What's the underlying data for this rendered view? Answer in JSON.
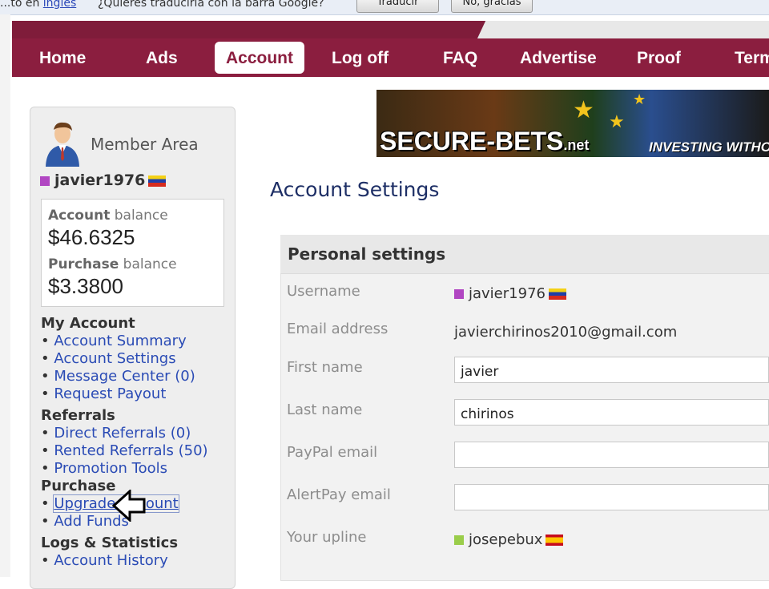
{
  "translate_bar": {
    "text_prefix": "...to en",
    "link": "inglés",
    "question": "¿Quieres traducirla con la barra Google?",
    "translate_button": "Traducir",
    "no_button": "No, gracias"
  },
  "nav": {
    "items": [
      "Home",
      "Ads",
      "Account",
      "Log off",
      "FAQ",
      "Advertise",
      "Proof",
      "Terms"
    ],
    "active": "Account"
  },
  "sidebar": {
    "member_area": "Member Area",
    "username": "javier1976",
    "account_balance_label": "Account",
    "account_balance_label2": "balance",
    "account_balance": "46.6325",
    "purchase_balance_label": "Purchase",
    "purchase_balance_label2": "balance",
    "purchase_balance": "3.3800",
    "currency": "$",
    "sections": {
      "my_account": "My Account",
      "account_summary": "Account Summary",
      "account_settings": "Account Settings",
      "message_center": "Message Center",
      "message_count": "(0)",
      "request_payout": "Request Payout",
      "referrals": "Referrals",
      "direct_referrals": "Direct Referrals",
      "direct_count": "(0)",
      "rented_referrals": "Rented Referrals",
      "rented_count": "(50)",
      "promotion_tools": "Promotion Tools",
      "purchase": "Purchase",
      "upgrade_account": "Upgrade Account",
      "add_funds": "Add Funds",
      "logs_statistics": "Logs & Statistics",
      "account_history": "Account History"
    }
  },
  "banner": {
    "brand": "SECURE-BETS",
    "brand_suffix": ".net",
    "tagline": "INVESTING WITHOUT"
  },
  "main": {
    "page_title": "Account Settings",
    "section_title": "Personal settings",
    "fields": {
      "username_label": "Username",
      "username_value": "javier1976",
      "email_label": "Email address",
      "email_value": "javierchirinos2010@gmail.com",
      "first_name_label": "First name",
      "first_name_value": "javier",
      "last_name_label": "Last name",
      "last_name_value": "chirinos",
      "paypal_label": "PayPal email",
      "paypal_value": "",
      "alertpay_label": "AlertPay email",
      "alertpay_value": "",
      "upline_label": "Your upline",
      "upline_value": "josepebux"
    }
  },
  "colors": {
    "nav": "#8b1e3f",
    "link": "#2a4bb5",
    "title": "#1e2f66"
  }
}
